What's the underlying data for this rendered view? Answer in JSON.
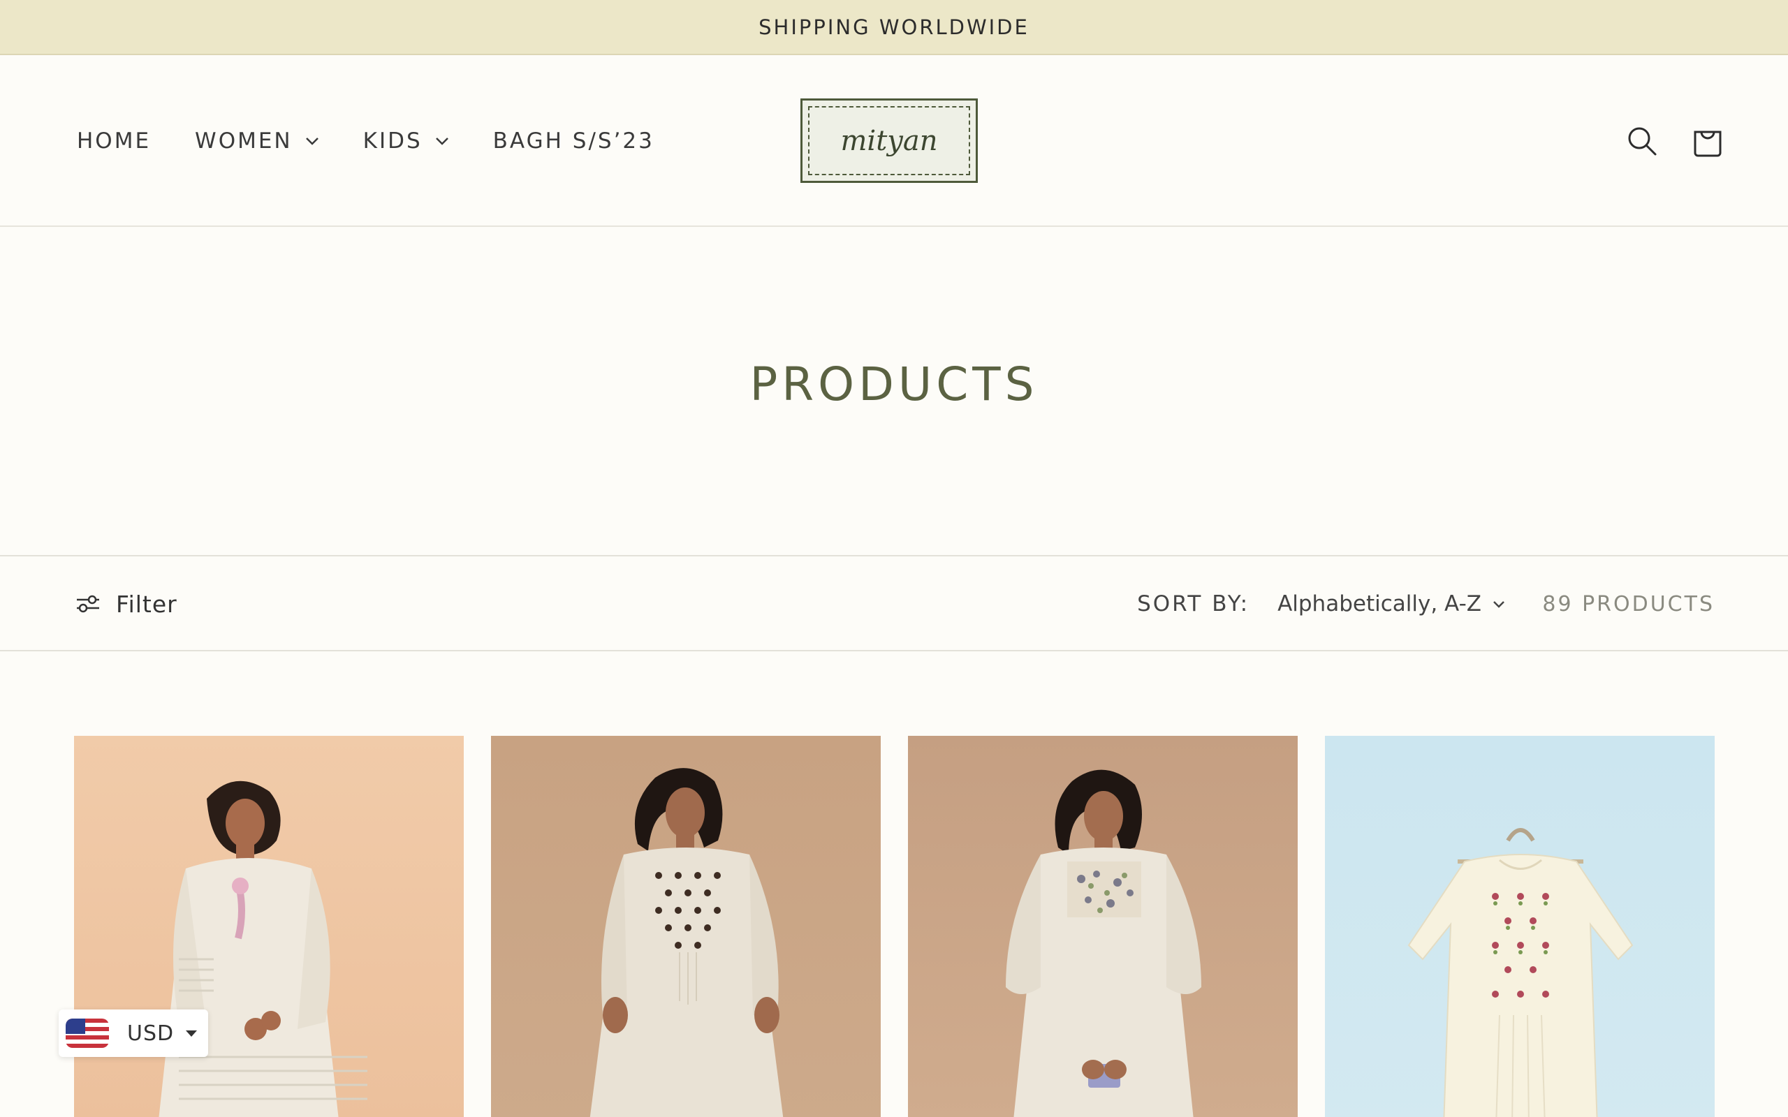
{
  "announcement": {
    "text": "SHIPPING WORLDWIDE"
  },
  "header": {
    "nav": [
      {
        "label": "HOME",
        "has_dropdown": false
      },
      {
        "label": "WOMEN",
        "has_dropdown": true
      },
      {
        "label": "KIDS",
        "has_dropdown": true
      },
      {
        "label": "BAGH S/S’23",
        "has_dropdown": false
      }
    ],
    "logo_text": "mityan",
    "icons": [
      "search-icon",
      "cart-icon"
    ]
  },
  "page": {
    "title": "PRODUCTS"
  },
  "toolbar": {
    "filter_label": "Filter",
    "sort_label": "SORT BY:",
    "sort_value": "Alphabetically, A-Z",
    "product_count": "89 PRODUCTS"
  },
  "products": [
    {
      "background": "#efc4a2",
      "garment": "#f1ece2"
    },
    {
      "background": "#c9a484",
      "garment": "#ece5d8"
    },
    {
      "background": "#c9a284",
      "garment": "#eee8dc"
    },
    {
      "background": "#cfe7f0",
      "garment": "#f6f1de"
    }
  ],
  "currency": {
    "code": "USD"
  },
  "colors": {
    "announcement_bg": "#ece7c8",
    "page_bg": "#fdfcf8",
    "title_color": "#5b6242",
    "logo_border": "#4e5a3a"
  }
}
